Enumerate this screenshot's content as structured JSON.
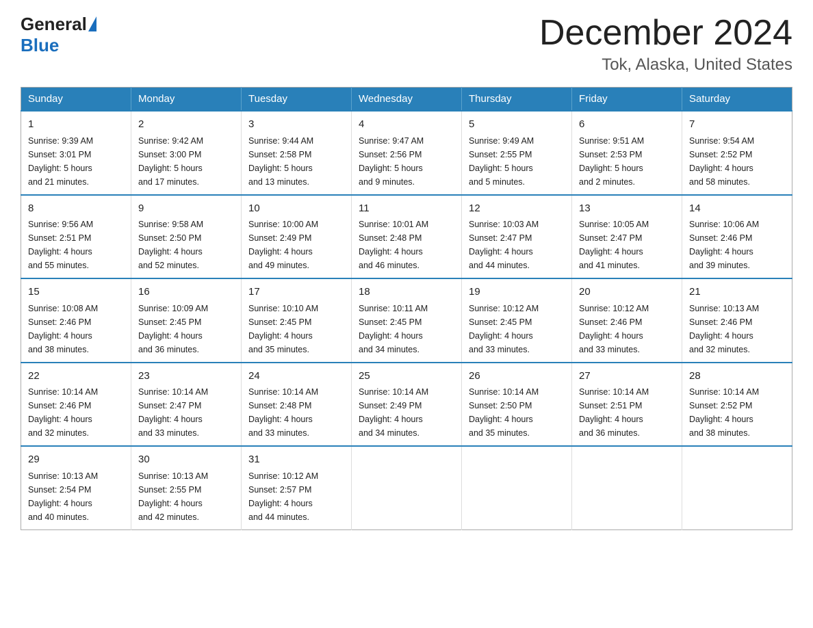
{
  "logo": {
    "general": "General",
    "blue": "Blue"
  },
  "title": "December 2024",
  "subtitle": "Tok, Alaska, United States",
  "weekdays": [
    "Sunday",
    "Monday",
    "Tuesday",
    "Wednesday",
    "Thursday",
    "Friday",
    "Saturday"
  ],
  "weeks": [
    [
      {
        "day": "1",
        "sunrise": "Sunrise: 9:39 AM",
        "sunset": "Sunset: 3:01 PM",
        "daylight": "Daylight: 5 hours",
        "daylight2": "and 21 minutes."
      },
      {
        "day": "2",
        "sunrise": "Sunrise: 9:42 AM",
        "sunset": "Sunset: 3:00 PM",
        "daylight": "Daylight: 5 hours",
        "daylight2": "and 17 minutes."
      },
      {
        "day": "3",
        "sunrise": "Sunrise: 9:44 AM",
        "sunset": "Sunset: 2:58 PM",
        "daylight": "Daylight: 5 hours",
        "daylight2": "and 13 minutes."
      },
      {
        "day": "4",
        "sunrise": "Sunrise: 9:47 AM",
        "sunset": "Sunset: 2:56 PM",
        "daylight": "Daylight: 5 hours",
        "daylight2": "and 9 minutes."
      },
      {
        "day": "5",
        "sunrise": "Sunrise: 9:49 AM",
        "sunset": "Sunset: 2:55 PM",
        "daylight": "Daylight: 5 hours",
        "daylight2": "and 5 minutes."
      },
      {
        "day": "6",
        "sunrise": "Sunrise: 9:51 AM",
        "sunset": "Sunset: 2:53 PM",
        "daylight": "Daylight: 5 hours",
        "daylight2": "and 2 minutes."
      },
      {
        "day": "7",
        "sunrise": "Sunrise: 9:54 AM",
        "sunset": "Sunset: 2:52 PM",
        "daylight": "Daylight: 4 hours",
        "daylight2": "and 58 minutes."
      }
    ],
    [
      {
        "day": "8",
        "sunrise": "Sunrise: 9:56 AM",
        "sunset": "Sunset: 2:51 PM",
        "daylight": "Daylight: 4 hours",
        "daylight2": "and 55 minutes."
      },
      {
        "day": "9",
        "sunrise": "Sunrise: 9:58 AM",
        "sunset": "Sunset: 2:50 PM",
        "daylight": "Daylight: 4 hours",
        "daylight2": "and 52 minutes."
      },
      {
        "day": "10",
        "sunrise": "Sunrise: 10:00 AM",
        "sunset": "Sunset: 2:49 PM",
        "daylight": "Daylight: 4 hours",
        "daylight2": "and 49 minutes."
      },
      {
        "day": "11",
        "sunrise": "Sunrise: 10:01 AM",
        "sunset": "Sunset: 2:48 PM",
        "daylight": "Daylight: 4 hours",
        "daylight2": "and 46 minutes."
      },
      {
        "day": "12",
        "sunrise": "Sunrise: 10:03 AM",
        "sunset": "Sunset: 2:47 PM",
        "daylight": "Daylight: 4 hours",
        "daylight2": "and 44 minutes."
      },
      {
        "day": "13",
        "sunrise": "Sunrise: 10:05 AM",
        "sunset": "Sunset: 2:47 PM",
        "daylight": "Daylight: 4 hours",
        "daylight2": "and 41 minutes."
      },
      {
        "day": "14",
        "sunrise": "Sunrise: 10:06 AM",
        "sunset": "Sunset: 2:46 PM",
        "daylight": "Daylight: 4 hours",
        "daylight2": "and 39 minutes."
      }
    ],
    [
      {
        "day": "15",
        "sunrise": "Sunrise: 10:08 AM",
        "sunset": "Sunset: 2:46 PM",
        "daylight": "Daylight: 4 hours",
        "daylight2": "and 38 minutes."
      },
      {
        "day": "16",
        "sunrise": "Sunrise: 10:09 AM",
        "sunset": "Sunset: 2:45 PM",
        "daylight": "Daylight: 4 hours",
        "daylight2": "and 36 minutes."
      },
      {
        "day": "17",
        "sunrise": "Sunrise: 10:10 AM",
        "sunset": "Sunset: 2:45 PM",
        "daylight": "Daylight: 4 hours",
        "daylight2": "and 35 minutes."
      },
      {
        "day": "18",
        "sunrise": "Sunrise: 10:11 AM",
        "sunset": "Sunset: 2:45 PM",
        "daylight": "Daylight: 4 hours",
        "daylight2": "and 34 minutes."
      },
      {
        "day": "19",
        "sunrise": "Sunrise: 10:12 AM",
        "sunset": "Sunset: 2:45 PM",
        "daylight": "Daylight: 4 hours",
        "daylight2": "and 33 minutes."
      },
      {
        "day": "20",
        "sunrise": "Sunrise: 10:12 AM",
        "sunset": "Sunset: 2:46 PM",
        "daylight": "Daylight: 4 hours",
        "daylight2": "and 33 minutes."
      },
      {
        "day": "21",
        "sunrise": "Sunrise: 10:13 AM",
        "sunset": "Sunset: 2:46 PM",
        "daylight": "Daylight: 4 hours",
        "daylight2": "and 32 minutes."
      }
    ],
    [
      {
        "day": "22",
        "sunrise": "Sunrise: 10:14 AM",
        "sunset": "Sunset: 2:46 PM",
        "daylight": "Daylight: 4 hours",
        "daylight2": "and 32 minutes."
      },
      {
        "day": "23",
        "sunrise": "Sunrise: 10:14 AM",
        "sunset": "Sunset: 2:47 PM",
        "daylight": "Daylight: 4 hours",
        "daylight2": "and 33 minutes."
      },
      {
        "day": "24",
        "sunrise": "Sunrise: 10:14 AM",
        "sunset": "Sunset: 2:48 PM",
        "daylight": "Daylight: 4 hours",
        "daylight2": "and 33 minutes."
      },
      {
        "day": "25",
        "sunrise": "Sunrise: 10:14 AM",
        "sunset": "Sunset: 2:49 PM",
        "daylight": "Daylight: 4 hours",
        "daylight2": "and 34 minutes."
      },
      {
        "day": "26",
        "sunrise": "Sunrise: 10:14 AM",
        "sunset": "Sunset: 2:50 PM",
        "daylight": "Daylight: 4 hours",
        "daylight2": "and 35 minutes."
      },
      {
        "day": "27",
        "sunrise": "Sunrise: 10:14 AM",
        "sunset": "Sunset: 2:51 PM",
        "daylight": "Daylight: 4 hours",
        "daylight2": "and 36 minutes."
      },
      {
        "day": "28",
        "sunrise": "Sunrise: 10:14 AM",
        "sunset": "Sunset: 2:52 PM",
        "daylight": "Daylight: 4 hours",
        "daylight2": "and 38 minutes."
      }
    ],
    [
      {
        "day": "29",
        "sunrise": "Sunrise: 10:13 AM",
        "sunset": "Sunset: 2:54 PM",
        "daylight": "Daylight: 4 hours",
        "daylight2": "and 40 minutes."
      },
      {
        "day": "30",
        "sunrise": "Sunrise: 10:13 AM",
        "sunset": "Sunset: 2:55 PM",
        "daylight": "Daylight: 4 hours",
        "daylight2": "and 42 minutes."
      },
      {
        "day": "31",
        "sunrise": "Sunrise: 10:12 AM",
        "sunset": "Sunset: 2:57 PM",
        "daylight": "Daylight: 4 hours",
        "daylight2": "and 44 minutes."
      },
      null,
      null,
      null,
      null
    ]
  ]
}
